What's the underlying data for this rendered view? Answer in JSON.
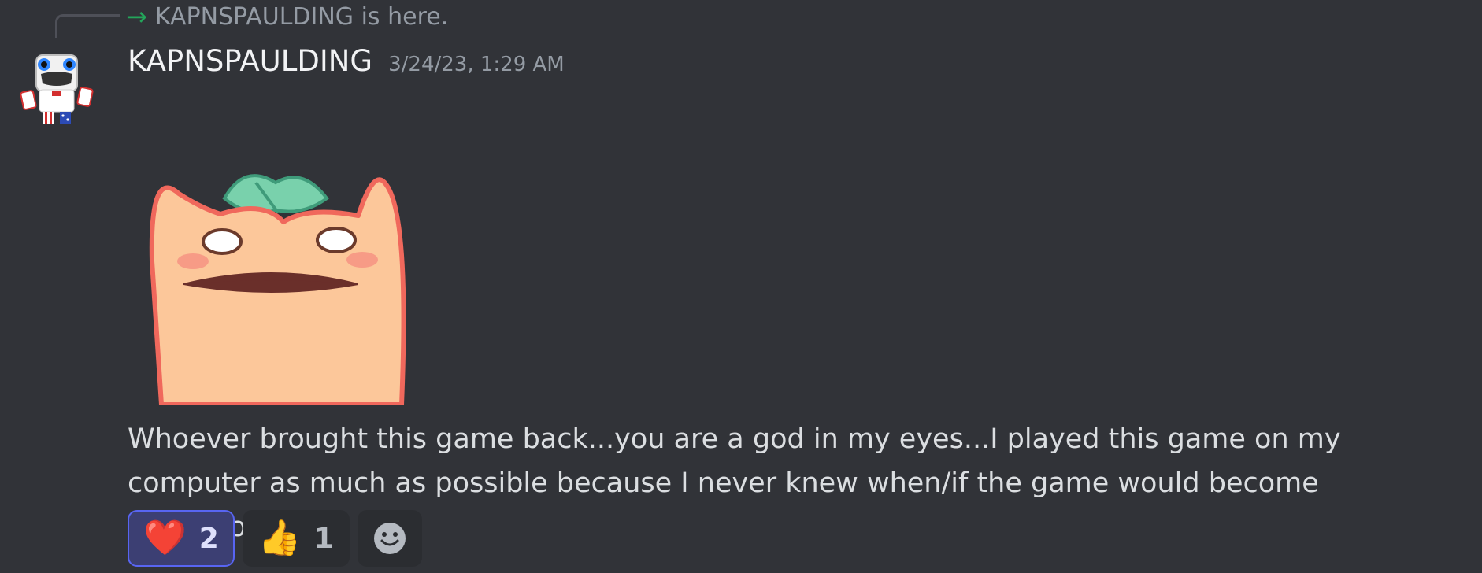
{
  "join_notice": {
    "text": "KAPNSPAULDING is here.",
    "arrow_color": "#23a55a"
  },
  "message": {
    "username": "KAPNSPAULDING",
    "timestamp": "3/24/23, 1:29 AM",
    "sticker_name": "peach-shocked-sticker",
    "text": "Whoever brought this game back...you are a god in my eyes...I played this game on my computer as much as possible because I never knew when/if the game would become unsupported..."
  },
  "reactions": [
    {
      "emoji": "❤️",
      "emoji_name": "heart",
      "count": "2",
      "active": true
    },
    {
      "emoji": "👍",
      "emoji_name": "thumbs-up",
      "count": "1",
      "active": false
    }
  ],
  "add_reaction_icon": "smiley-icon",
  "colors": {
    "background": "#313338",
    "accent": "#5865f2",
    "username": "#f2f3f5",
    "muted": "#949ba4"
  }
}
